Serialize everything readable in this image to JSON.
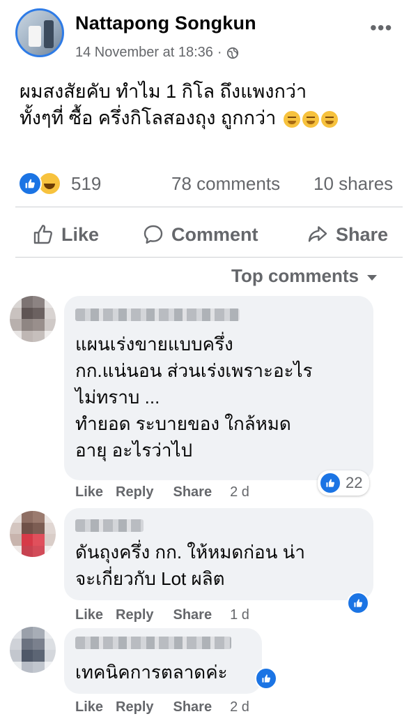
{
  "post": {
    "author": "Nattapong Songkun",
    "timestamp": "14 November at 18:36",
    "visibility_icon": "globe-icon",
    "text_lines": [
      "ผมสงสัยคับ ทำไม 1 กิโล ถึงแพงกว่า",
      "ทั้งๆที่ ซื้อ ครึ่งกิโลสองถุง ถูกกว่า"
    ],
    "trailing_emoji": [
      "thinking-face",
      "thinking-face",
      "thinking-face"
    ]
  },
  "stats": {
    "reactions": "519",
    "comments": "78 comments",
    "shares": "10 shares",
    "reaction_icons": [
      "like",
      "haha"
    ]
  },
  "actions": {
    "like": "Like",
    "comment": "Comment",
    "share": "Share"
  },
  "sort": {
    "label": "Top comments"
  },
  "comments": [
    {
      "lines": [
        "แผนเร่งขายแบบครึ่ง",
        "กก.แน่นอน ส่วนเร่งเพราะอะไร",
        "ไม่ทราบ ...",
        "ทำยอด ระบายของ ใกล้หมด",
        "อายุ อะไรว่าไป"
      ],
      "like": "Like",
      "reply": "Reply",
      "share": "Share",
      "time": "2 d",
      "reactions": "22"
    },
    {
      "lines": [
        "ดันถุงครึ่ง กก. ให้หมดก่อน น่า",
        "จะเกี่ยวกับ Lot ผลิต"
      ],
      "like": "Like",
      "reply": "Reply",
      "share": "Share",
      "time": "1 d"
    },
    {
      "lines": [
        "เทคนิคการตลาดค่ะ"
      ],
      "like": "Like",
      "reply": "Reply",
      "share": "Share",
      "time": "2 d"
    }
  ],
  "colors": {
    "brand_blue": "#1b74e4",
    "secondary_text": "#65676b",
    "bubble": "#f0f2f5"
  }
}
